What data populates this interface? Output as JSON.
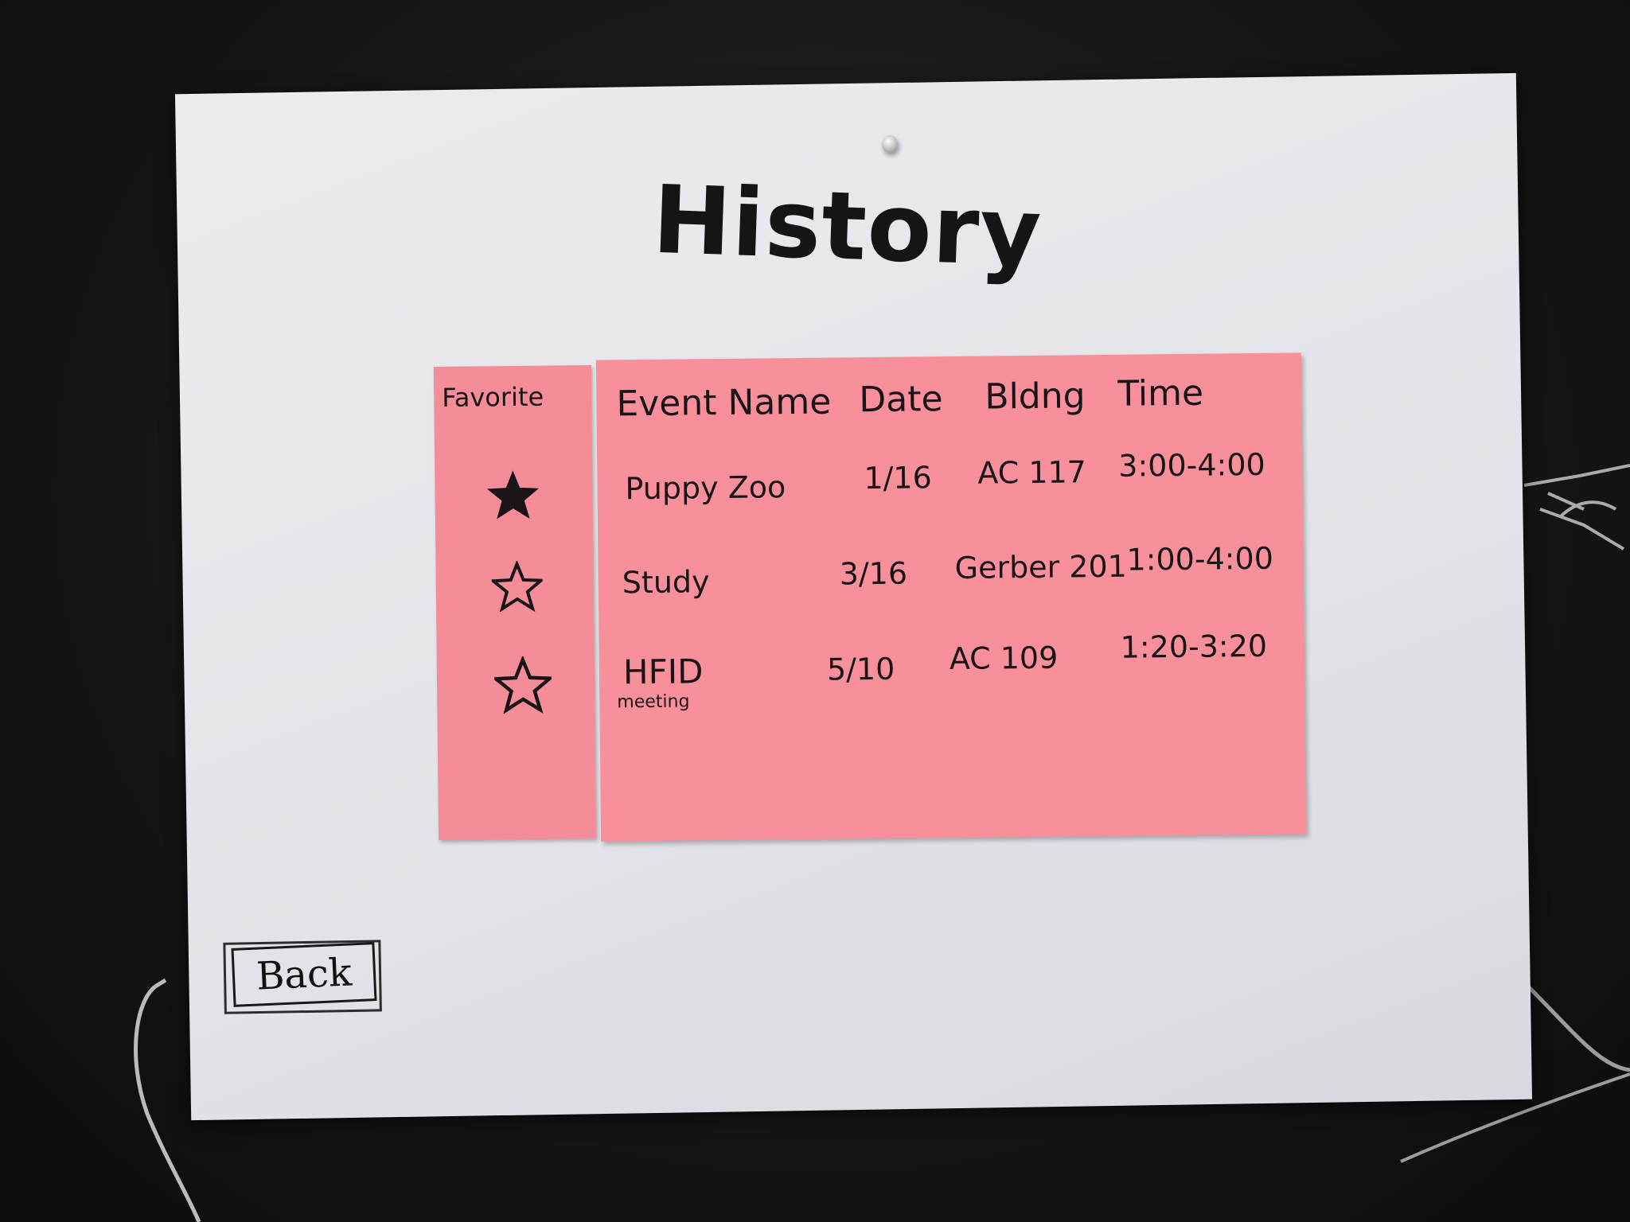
{
  "screen": {
    "title": "History",
    "back_label": "Back"
  },
  "table": {
    "favorite_header": "Favorite",
    "columns": [
      "Event Name",
      "Date",
      "Bldng",
      "Time"
    ],
    "rows": [
      {
        "favorite": true,
        "event": "Puppy Zoo",
        "event_sub": "",
        "date": "1/16",
        "building": "AC 117",
        "time": "3:00-4:00"
      },
      {
        "favorite": false,
        "event": "Study",
        "event_sub": "",
        "date": "3/16",
        "building": "Gerber 201",
        "time": "1:00-4:00"
      },
      {
        "favorite": false,
        "event": "HFID",
        "event_sub": "meeting",
        "date": "5/10",
        "building": "AC 109",
        "time": "1:20-3:20"
      }
    ]
  },
  "colors": {
    "sticky_note": "#f7909a",
    "paper": "#e6e7ec",
    "chalkboard": "#161616",
    "ink": "#1a1418"
  },
  "icons": {
    "favorite_on": "filled-star-icon",
    "favorite_off": "outline-star-icon"
  }
}
